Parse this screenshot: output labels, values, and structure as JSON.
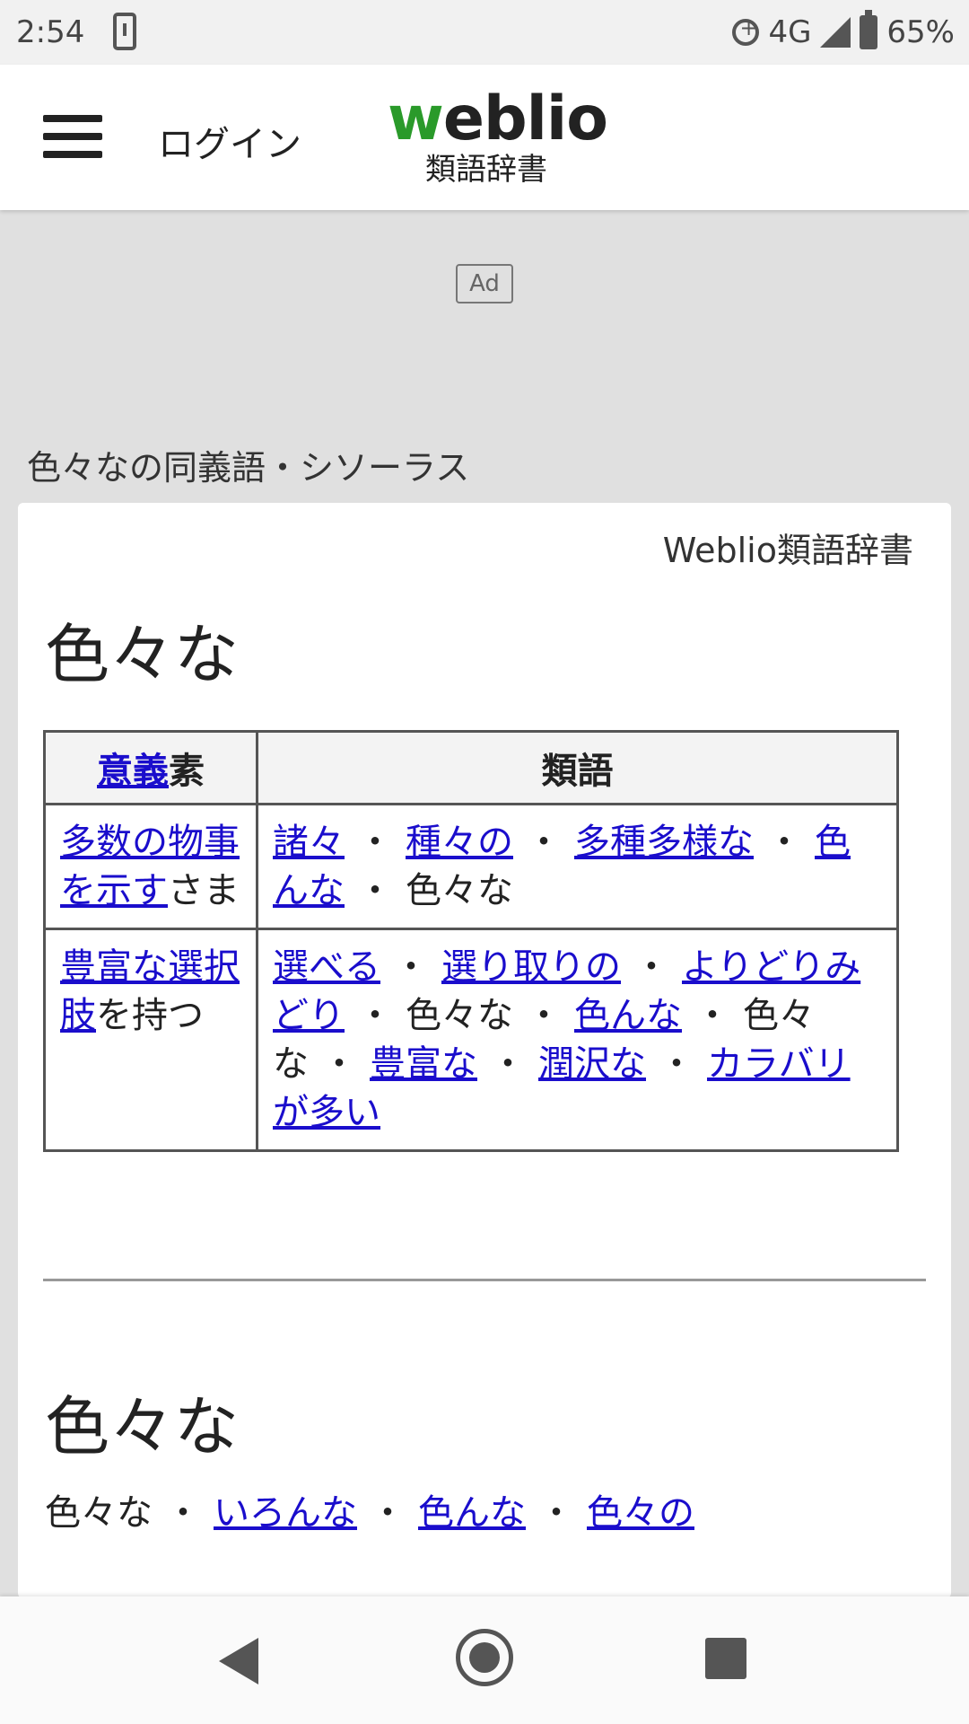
{
  "status_bar": {
    "time": "2:54",
    "network": "4G",
    "battery": "65%"
  },
  "header": {
    "login": "ログイン",
    "logo_prefix": "w",
    "logo_rest": "eblio",
    "logo_sub": "類語辞書"
  },
  "ad": {
    "label": "Ad"
  },
  "section_label": "色々なの同義語・シソーラス",
  "card": {
    "source": "Weblio類語辞書",
    "title": "色々な",
    "table": {
      "header_sense_link": "意義",
      "header_sense_rest": "素",
      "header_synonyms": "類語",
      "rows": [
        {
          "sense_link": "多数の物事を示す",
          "sense_rest": "さま",
          "synonyms": [
            {
              "text": "諸々",
              "link": true
            },
            {
              "text": "種々の",
              "link": true
            },
            {
              "text": "多種多様な",
              "link": true
            },
            {
              "text": "色んな",
              "link": true
            },
            {
              "text": "色々な",
              "link": false
            }
          ]
        },
        {
          "sense_link": "豊富な選択肢",
          "sense_rest": "を持つ",
          "synonyms": [
            {
              "text": "選べる",
              "link": true
            },
            {
              "text": "選り取りの",
              "link": true
            },
            {
              "text": "よりどりみどり",
              "link": true
            },
            {
              "text": "色々な",
              "link": false
            },
            {
              "text": "色んな",
              "link": true
            },
            {
              "text": "色々な",
              "link": false
            },
            {
              "text": "豊富な",
              "link": true
            },
            {
              "text": "潤沢な",
              "link": true
            },
            {
              "text": "カラバリが多い",
              "link": true
            }
          ]
        }
      ]
    },
    "title2": "色々な",
    "list2": [
      {
        "text": "色々な",
        "link": false
      },
      {
        "text": "いろんな",
        "link": true
      },
      {
        "text": "色んな",
        "link": true
      },
      {
        "text": "色々の",
        "link": true
      }
    ]
  }
}
